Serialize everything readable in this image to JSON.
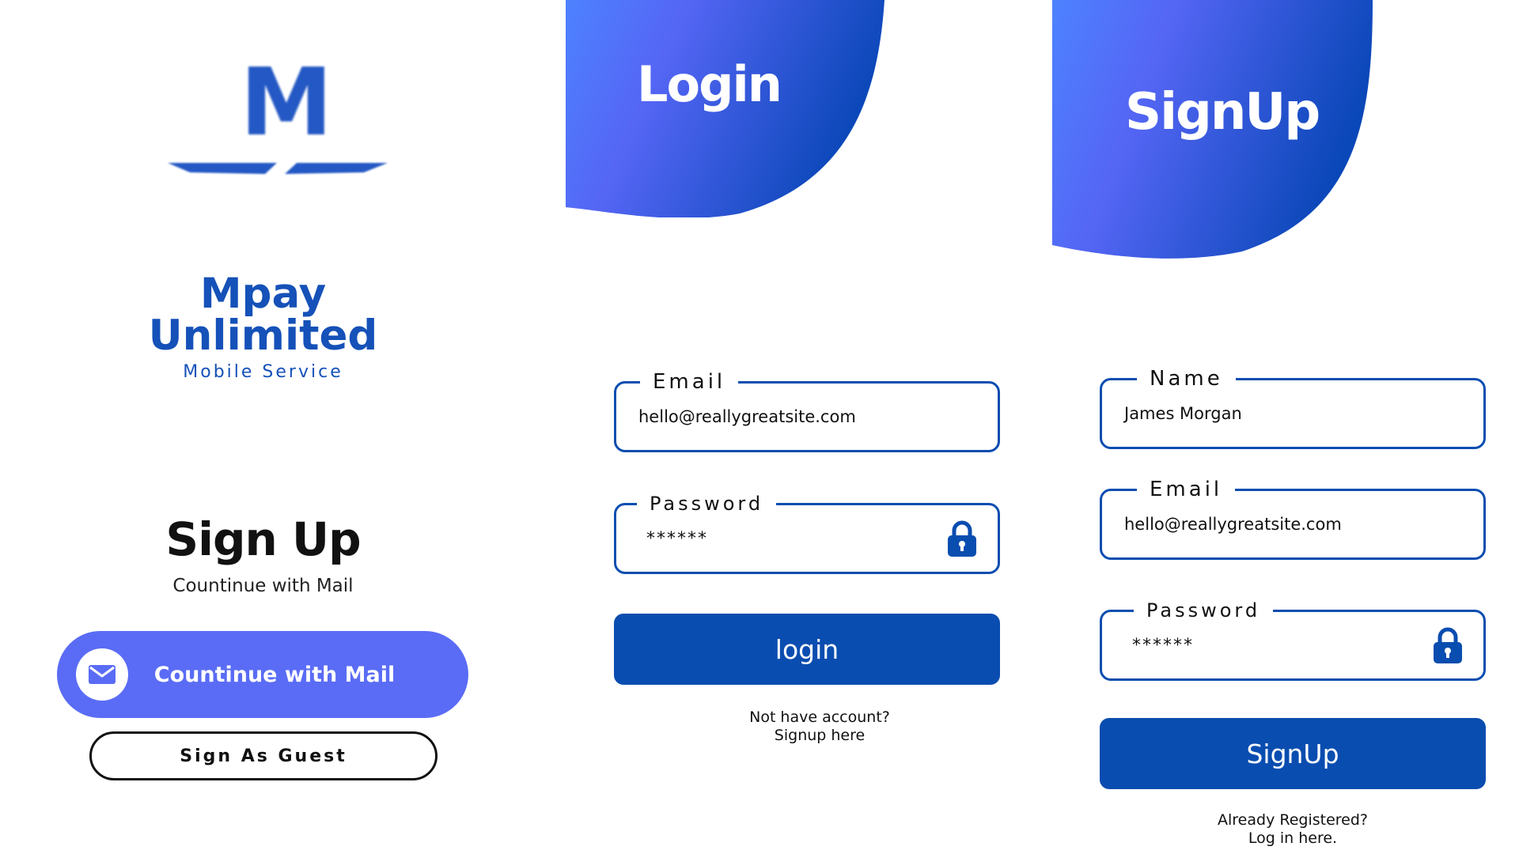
{
  "colors": {
    "brand_blue": "#1551b8",
    "primary": "#0a4db0",
    "mail_button": "#5a6cf5",
    "gradient_start": "#4d7dff",
    "gradient_end": "#0a47b8"
  },
  "welcome": {
    "logo_letter": "M",
    "brand_line1": "Mpay",
    "brand_line2": "Unlimited",
    "brand_sub": "Mobile Service",
    "title": "Sign Up",
    "subtitle": "Countinue with Mail",
    "mail_button_label": "Countinue with Mail",
    "mail_icon": "mail-icon",
    "guest_button_label": "Sign As Guest"
  },
  "login": {
    "header": "Login",
    "email_label": "Email",
    "email_value": "hello@reallygreatsite.com",
    "password_label": "Password",
    "password_value": "******",
    "lock_icon": "lock-icon",
    "button_label": "login",
    "hint_line1": "Not have account?",
    "hint_line2": "Signup here"
  },
  "signup": {
    "header": "SignUp",
    "name_label": "Name",
    "name_value": "James Morgan",
    "email_label": "Email",
    "email_value": "hello@reallygreatsite.com",
    "password_label": "Password",
    "password_value": "******",
    "lock_icon": "lock-icon",
    "button_label": "SignUp",
    "hint_line1": "Already Registered?",
    "hint_line2": "Log in here."
  }
}
